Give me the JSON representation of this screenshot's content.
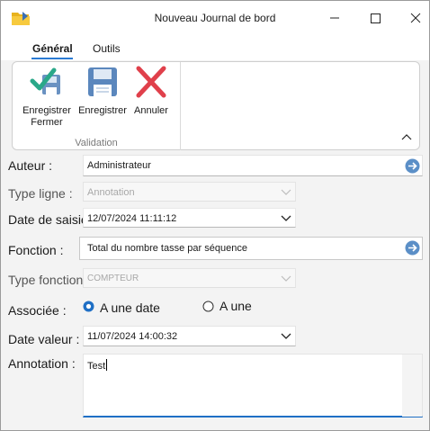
{
  "window": {
    "title": "Nouveau Journal de bord"
  },
  "tabs": [
    {
      "label": "Général",
      "active": true
    },
    {
      "label": "Outils",
      "active": false
    }
  ],
  "ribbon": {
    "buttons": [
      {
        "label_line1": "Enregistrer",
        "label_line2": "Fermer",
        "icon": "save-close-icon"
      },
      {
        "label": "Enregistrer",
        "icon": "save-icon"
      },
      {
        "label": "Annuler",
        "icon": "cancel-icon"
      }
    ],
    "group_label": "Validation"
  },
  "form": {
    "auteur": {
      "label": "Auteur :",
      "value": "Administrateur"
    },
    "type_ligne": {
      "label": "Type ligne :",
      "value": "Annotation",
      "disabled": true
    },
    "date_saisie": {
      "label": "Date de saisie",
      "value": "12/07/2024 11:11:12"
    },
    "fonction": {
      "label": "Fonction :",
      "value": "Total du nombre tasse par séquence"
    },
    "type_fonction": {
      "label": "Type fonction",
      "value": "COMPTEUR",
      "disabled": true
    },
    "associee": {
      "label": "Associée :",
      "options": [
        {
          "label": "A une date",
          "checked": true
        },
        {
          "label": "A une",
          "checked": false
        }
      ]
    },
    "date_valeur": {
      "label": "Date valeur :",
      "value": "11/07/2024 14:00:32"
    },
    "annotation": {
      "label": "Annotation :",
      "value": "Test"
    }
  },
  "colors": {
    "accent": "#1f6fc5",
    "go_button": "#5b8fc7",
    "cancel": "#e0404b",
    "check": "#2aa889"
  }
}
